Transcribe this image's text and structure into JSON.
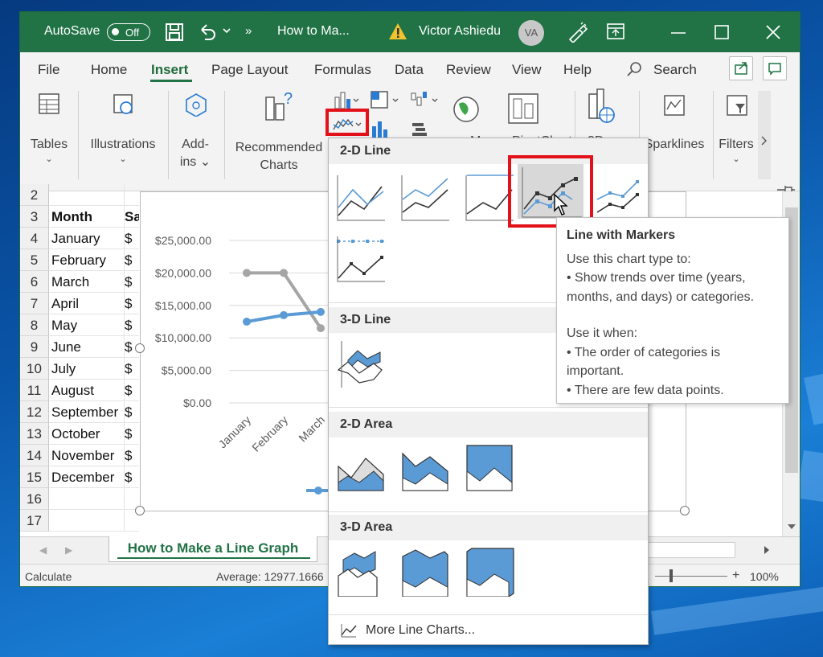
{
  "titlebar": {
    "autosave_label": "AutoSave",
    "autosave_state": "Off",
    "doc_title": "How to Ma...",
    "user_name": "Victor Ashiedu",
    "user_initials": "VA",
    "more_glyph": "»"
  },
  "menu": {
    "items": [
      "File",
      "Home",
      "Insert",
      "Page Layout",
      "Formulas",
      "Data",
      "Review",
      "View",
      "Help"
    ],
    "active": "Insert",
    "search_label": "Search"
  },
  "ribbon": {
    "tables": "Tables",
    "illustrations": "Illustrations",
    "addins_1": "Add-",
    "addins_2": "ins",
    "recommended_1": "Recommended",
    "recommended_2": "Charts",
    "sparklines": "Sparklines",
    "filters": "Filters",
    "partial_maps": "M",
    "partial_pivot": "PivotChart",
    "partial_3d": "3D"
  },
  "sheet": {
    "rows": [
      {
        "num": "2",
        "a": "",
        "b": ""
      },
      {
        "num": "3",
        "a": "Month",
        "b": "Sa",
        "bold": true
      },
      {
        "num": "4",
        "a": "January",
        "b": "$"
      },
      {
        "num": "5",
        "a": "February",
        "b": "$"
      },
      {
        "num": "6",
        "a": "March",
        "b": "$"
      },
      {
        "num": "7",
        "a": "April",
        "b": "$"
      },
      {
        "num": "8",
        "a": "May",
        "b": "$"
      },
      {
        "num": "9",
        "a": "June",
        "b": "$"
      },
      {
        "num": "10",
        "a": "July",
        "b": "$"
      },
      {
        "num": "11",
        "a": "August",
        "b": "$"
      },
      {
        "num": "12",
        "a": "September",
        "b": "$"
      },
      {
        "num": "13",
        "a": "October",
        "b": "$"
      },
      {
        "num": "14",
        "a": "November",
        "b": "$"
      },
      {
        "num": "15",
        "a": "December",
        "b": "$"
      },
      {
        "num": "16",
        "a": "",
        "b": ""
      },
      {
        "num": "17",
        "a": "",
        "b": ""
      }
    ],
    "tab_name": "How to Make a Line Graph"
  },
  "chart_data": {
    "type": "line",
    "title": "",
    "xlabel": "",
    "ylabel": "",
    "categories": [
      "January",
      "February",
      "March"
    ],
    "y_tick_labels": [
      "$25,000.00",
      "$20,000.00",
      "$15,000.00",
      "$10,000.00",
      "$5,000.00",
      "$0.00"
    ],
    "ylim": [
      0,
      25000
    ],
    "series": [
      {
        "values": [
          20000,
          20000,
          11500
        ],
        "color": "#a5a5a5"
      },
      {
        "values": [
          12500,
          13500,
          14000
        ],
        "color": "#5b9bd5"
      }
    ]
  },
  "status": {
    "left": "Calculate",
    "average": "Average: 12977.1666",
    "zoom": "100%",
    "plus": "+"
  },
  "dropdown": {
    "sec_2d_line": "2-D Line",
    "sec_3d_line": "3-D Line",
    "sec_2d_area": "2-D Area",
    "sec_3d_area": "3-D Area",
    "more_line_charts": "More Line Charts..."
  },
  "tooltip": {
    "title": "Line with Markers",
    "line1": "Use this chart type to:",
    "line2": "• Show trends over time (years, months, and days) or categories.",
    "line3": "Use it when:",
    "line4": "• The order of categories is important.",
    "line5": "• There are few data points."
  },
  "colors": {
    "excel_green": "#217346",
    "chart_blue": "#5b9bd5",
    "chart_gray": "#a5a5a5",
    "highlight_red": "#e3111a"
  }
}
